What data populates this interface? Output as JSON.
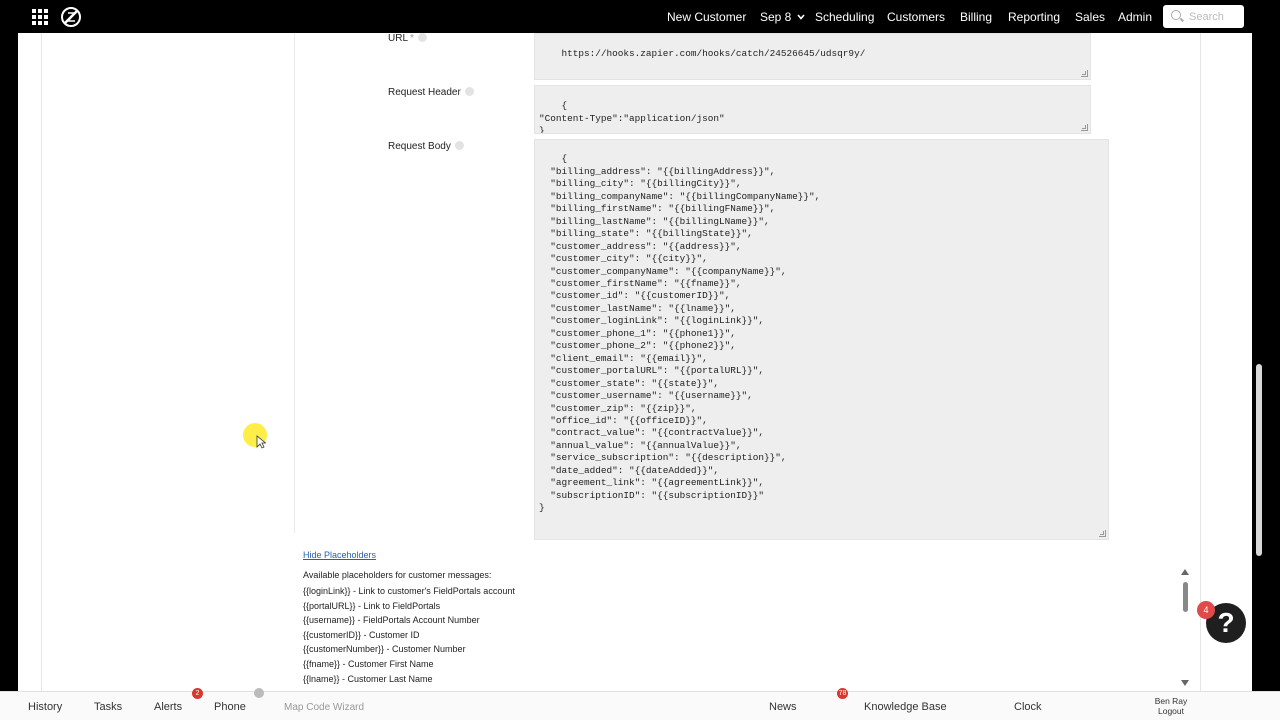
{
  "nav": {
    "new_customer": "New Customer",
    "date": "Sep 8",
    "scheduling": "Scheduling",
    "customers": "Customers",
    "billing": "Billing",
    "reporting": "Reporting",
    "sales": "Sales",
    "admin": "Admin",
    "search_placeholder": "Search"
  },
  "form": {
    "url_label": "URL",
    "url_required": "*",
    "url_value": "https://hooks.zapier.com/hooks/catch/24526645/udsqr9y/",
    "header_label": "Request Header",
    "header_value": "{\n\"Content-Type\":\"application/json\"\n}",
    "body_label": "Request Body",
    "body_value": "{\n  \"billing_address\": \"{{billingAddress}}\",\n  \"billing_city\": \"{{billingCity}}\",\n  \"billing_companyName\": \"{{billingCompanyName}}\",\n  \"billing_firstName\": \"{{billingFName}}\",\n  \"billing_lastName\": \"{{billingLName}}\",\n  \"billing_state\": \"{{billingState}}\",\n  \"customer_address\": \"{{address}}\",\n  \"customer_city\": \"{{city}}\",\n  \"customer_companyName\": \"{{companyName}}\",\n  \"customer_firstName\": \"{{fname}}\",\n  \"customer_id\": \"{{customerID}}\",\n  \"customer_lastName\": \"{{lname}}\",\n  \"customer_loginLink\": \"{{loginLink}}\",\n  \"customer_phone_1\": \"{{phone1}}\",\n  \"customer_phone_2\": \"{{phone2}}\",\n  \"client_email\": \"{{email}}\",\n  \"customer_portalURL\": \"{{portalURL}}\",\n  \"customer_state\": \"{{state}}\",\n  \"customer_username\": \"{{username}}\",\n  \"customer_zip\": \"{{zip}}\",\n  \"office_id\": \"{{officeID}}\",\n  \"contract_value\": \"{{contractValue}}\",\n  \"annual_value\": \"{{annualValue}}\",\n  \"service_subscription\": \"{{description}}\",\n  \"date_added\": \"{{dateAdded}}\",\n  \"agreement_link\": \"{{agreementLink}}\",\n  \"subscriptionID\": \"{{subscriptionID}}\"\n}"
  },
  "placeholders": {
    "hide_link": "Hide Placeholders",
    "title": "Available placeholders for customer messages:",
    "items": [
      "{{loginLink}} - Link to customer's FieldPortals account",
      "{{portalURL}} - Link to FieldPortals",
      "{{username}} - FieldPortals Account Number",
      "{{customerID}} - Customer ID",
      "{{customerNumber}} - Customer Number",
      "{{fname}} - Customer First Name",
      "{{lname}} - Customer Last Name"
    ]
  },
  "help": {
    "badge_count": "4",
    "icon": "question-mark-icon"
  },
  "bottom": {
    "history": "History",
    "tasks": "Tasks",
    "alerts": "Alerts",
    "alerts_badge": "2",
    "phone": "Phone",
    "map_code_wizard": "Map Code Wizard",
    "news": "News",
    "news_badge": "78",
    "knowledge_base": "Knowledge Base",
    "clock": "Clock",
    "user_name": "Ben Ray",
    "logout": "Logout"
  }
}
